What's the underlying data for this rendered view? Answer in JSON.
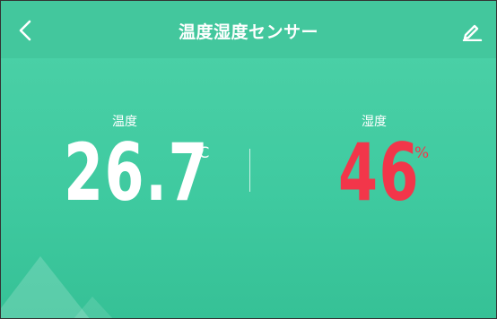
{
  "header": {
    "title": "温度湿度センサー",
    "back_icon": "chevron-left-icon",
    "edit_icon": "pencil-icon"
  },
  "temperature": {
    "label": "温度",
    "value": "26.7",
    "unit": "°C",
    "color": "#ffffff"
  },
  "humidity": {
    "label": "湿度",
    "value": "46",
    "unit": "%",
    "color": "#f2364a"
  },
  "colors": {
    "background": "#3fcaa0",
    "header": "#43c79d",
    "accent_red": "#f2364a"
  }
}
